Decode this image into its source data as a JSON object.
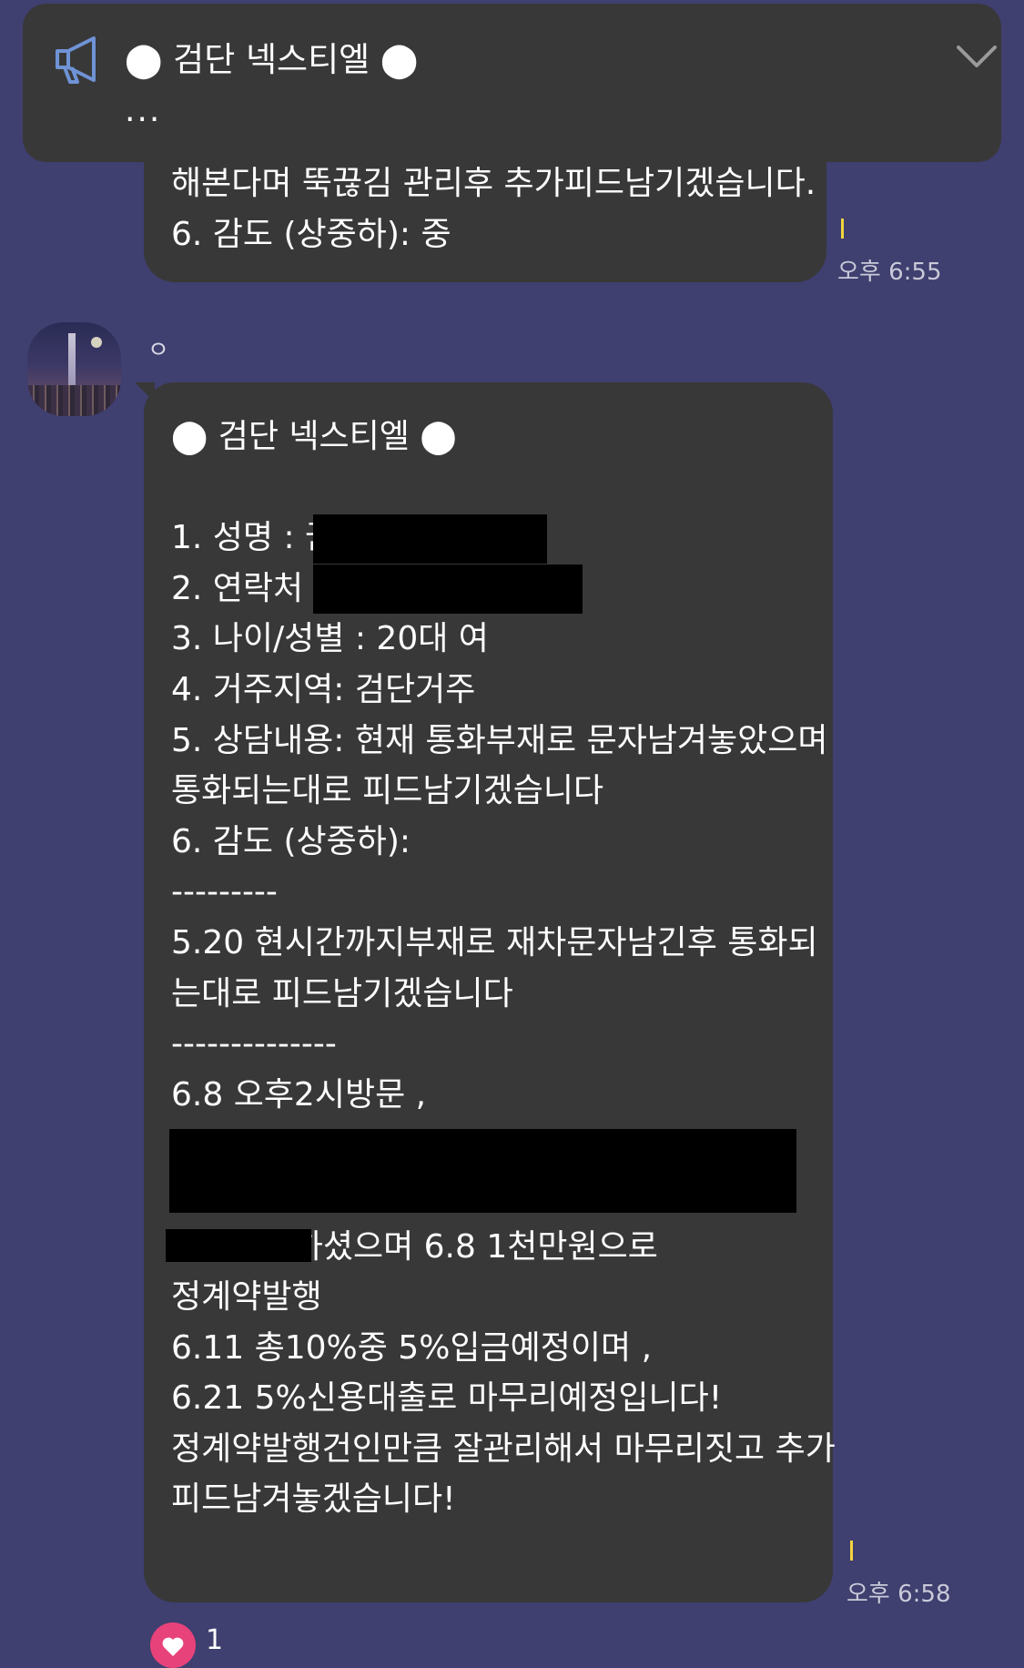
{
  "notice": {
    "title": "⬤ 검단 넥스티엘 ⬤",
    "preview": "..."
  },
  "message1": {
    "lines": [
      "해본다며 뚝끊김 관리후 추가피드남기겠습니다.",
      "6. 감도 (상중하): 중"
    ],
    "time": "오후 6:55"
  },
  "message2": {
    "sender": "ㅇ",
    "lines": [
      "⬤ 검단 넥스티엘 ⬤",
      "",
      "1. 성명 : 권",
      "2. 연락처 :",
      "3. 나이/성별 : 20대 여",
      "4. 거주지역: 검단거주",
      "5. 상담내용: 현재 통화부재로 문자남겨놓았으며",
      "통화되는대로 피드남기겠습니다",
      "6. 감도 (상중하):",
      "---------",
      "5.20 현시간까지부재로 재차문자남긴후 통화되",
      "는대로 피드남기겠습니다",
      "--------------",
      "6.8 오후2시방문 ,",
      "",
      "",
      "9호 계약하셨으며 6.8 1천만원으로",
      "정계약발행",
      "6.11 총10%중 5%입금예정이며 ,",
      "6.21 5%신용대출로 마무리예정입니다!",
      "정계약발행건인만큼 잘관리해서 마무리짓고 추가",
      "피드남겨놓겠습니다!"
    ],
    "time": "오후 6:58"
  },
  "reaction": {
    "icon": "heart-icon",
    "count": "1"
  },
  "colors": {
    "background": "#3f3f70",
    "bubble": "#383838",
    "unread_marker": "#f1d53c",
    "reaction": "#e8427a"
  }
}
